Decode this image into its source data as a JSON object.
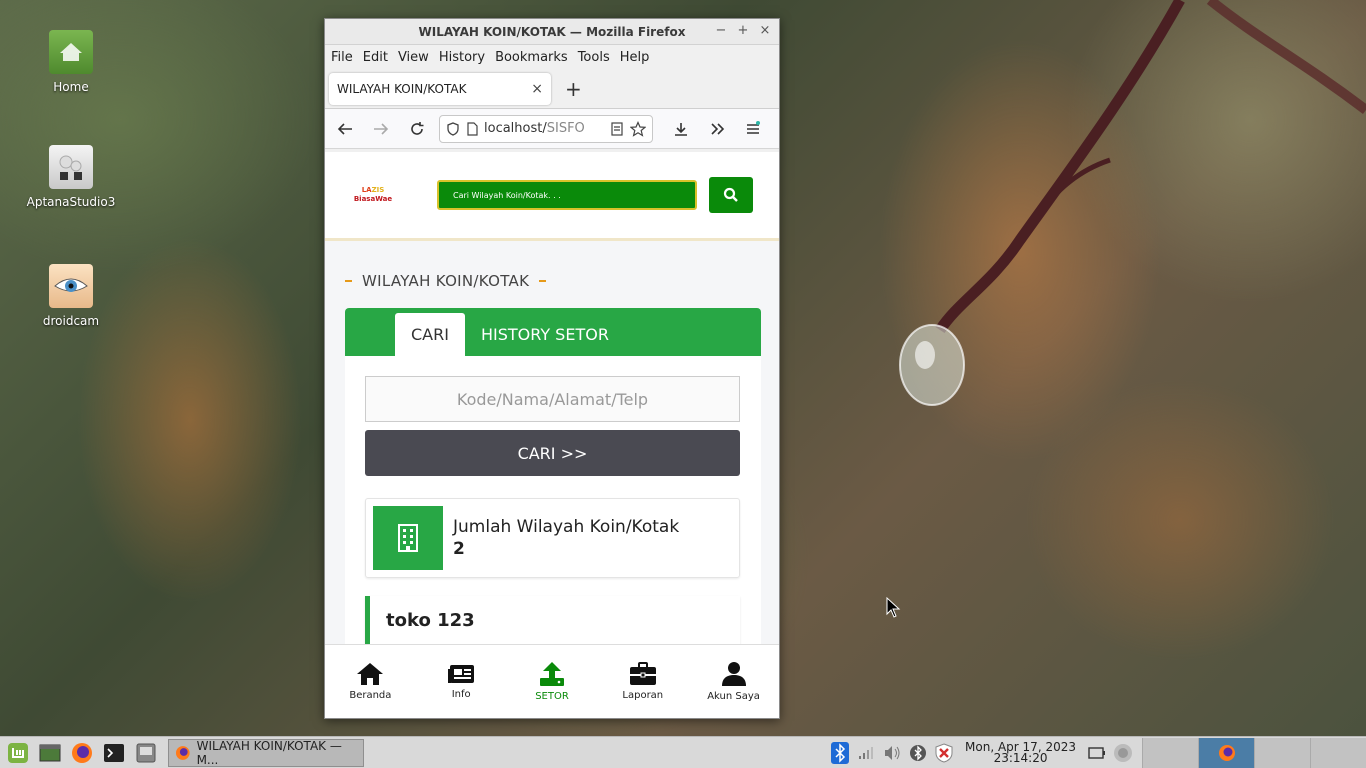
{
  "desktop": {
    "icons": [
      {
        "label": "Home",
        "icon": "home-folder-icon"
      },
      {
        "label": "AptanaStudio3",
        "icon": "aptana-icon"
      },
      {
        "label": "droidcam",
        "icon": "droidcam-icon"
      }
    ]
  },
  "window": {
    "title": "WILAYAH KOIN/KOTAK — Mozilla Firefox",
    "controls": [
      "−",
      "+",
      "×"
    ]
  },
  "menubar": {
    "items": [
      "File",
      "Edit",
      "View",
      "History",
      "Bookmarks",
      "Tools",
      "Help"
    ]
  },
  "browser": {
    "tab_title": "WILAYAH KOIN/KOTAK",
    "tab_close": "×",
    "new_tab": "+",
    "url_host": "localhost/",
    "url_path": "SISFO"
  },
  "site": {
    "logo_line1_a": "LA",
    "logo_line1_b": "ZIS",
    "logo_line2": "BiasaWae",
    "search_placeholder": "Cari Wilayah Koin/Kotak. . .",
    "section_title": "WILAYAH KOIN/KOTAK",
    "tabs": [
      "CARI",
      "HISTORY SETOR"
    ],
    "kode_placeholder": "Kode/Nama/Alamat/Telp",
    "cari_button": "CARI >>",
    "stat_label": "Jumlah Wilayah Koin/Kotak",
    "stat_value": "2",
    "item_name": "toko 123",
    "bottom_nav": [
      {
        "label": "Beranda",
        "icon": "home-icon",
        "active": false
      },
      {
        "label": "Info",
        "icon": "newspaper-icon",
        "active": false
      },
      {
        "label": "SETOR",
        "icon": "upload-icon",
        "active": true
      },
      {
        "label": "Laporan",
        "icon": "briefcase-icon",
        "active": false
      },
      {
        "label": "Akun Saya",
        "icon": "user-icon",
        "active": false
      }
    ],
    "colors": {
      "primary_green": "#28a745",
      "dark_green": "#0a8a0a",
      "accent_orange": "#e69a1a"
    }
  },
  "taskbar": {
    "task_label": "WILAYAH KOIN/KOTAK — M...",
    "clock_date": "Mon, Apr 17, 2023",
    "clock_time": "23:14:20"
  }
}
